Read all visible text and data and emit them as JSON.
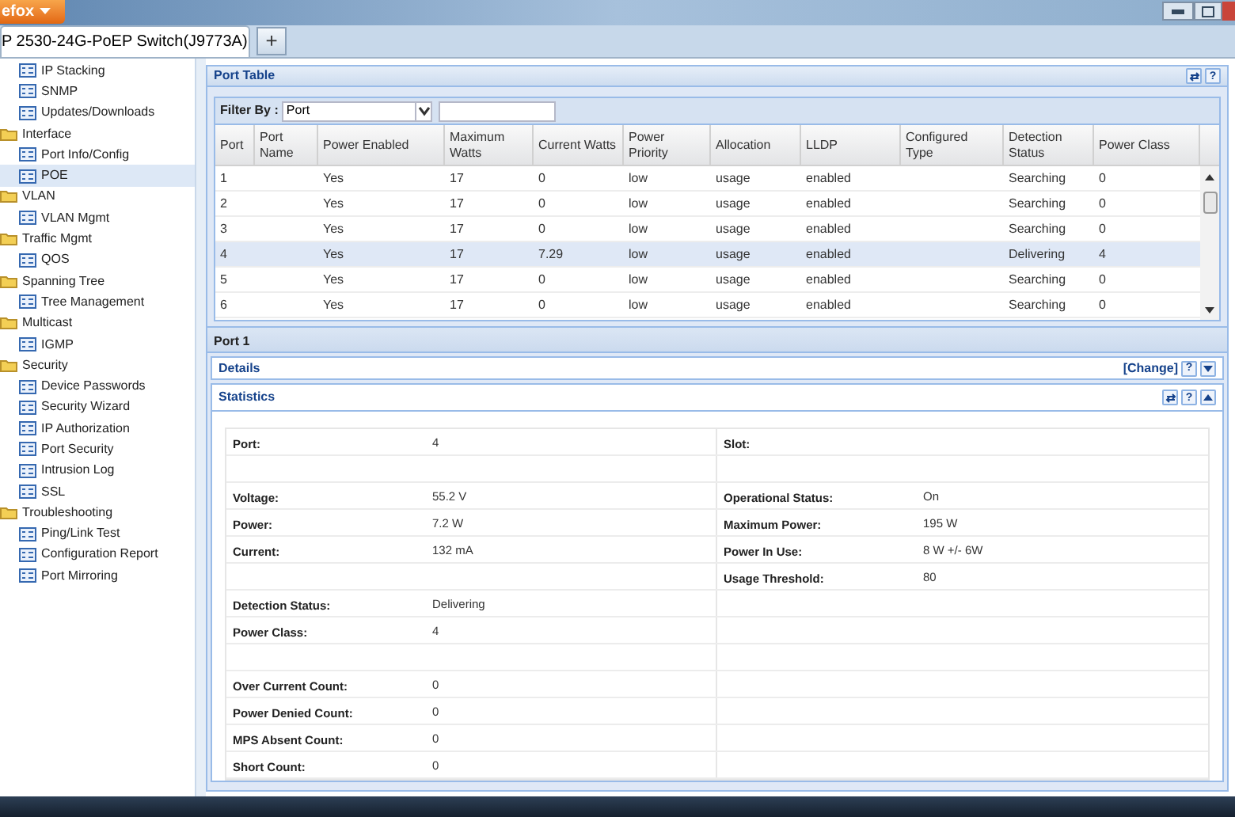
{
  "browser": {
    "menu_button": "efox",
    "tab_title": "P 2530-24G-PoEP Switch(J9773A)",
    "new_tab": "+"
  },
  "sidebar": {
    "items": [
      {
        "kind": "page",
        "label": "IP Stacking",
        "selected": false
      },
      {
        "kind": "page",
        "label": "SNMP",
        "selected": false
      },
      {
        "kind": "page",
        "label": "Updates/Downloads",
        "selected": false
      },
      {
        "kind": "folder",
        "label": "Interface",
        "selected": false,
        "children": [
          {
            "kind": "page",
            "label": "Port Info/Config",
            "selected": false
          },
          {
            "kind": "page",
            "label": "POE",
            "selected": true
          }
        ]
      },
      {
        "kind": "folder",
        "label": "VLAN",
        "selected": false,
        "children": [
          {
            "kind": "page",
            "label": "VLAN Mgmt",
            "selected": false
          }
        ]
      },
      {
        "kind": "folder",
        "label": "Traffic Mgmt",
        "selected": false,
        "children": [
          {
            "kind": "page",
            "label": "QOS",
            "selected": false
          }
        ]
      },
      {
        "kind": "folder",
        "label": "Spanning Tree",
        "selected": false,
        "children": [
          {
            "kind": "page",
            "label": "Tree Management",
            "selected": false
          }
        ]
      },
      {
        "kind": "folder",
        "label": "Multicast",
        "selected": false,
        "children": [
          {
            "kind": "page",
            "label": "IGMP",
            "selected": false
          }
        ]
      },
      {
        "kind": "folder",
        "label": "Security",
        "selected": false,
        "children": [
          {
            "kind": "page",
            "label": "Device Passwords",
            "selected": false
          },
          {
            "kind": "page",
            "label": "Security Wizard",
            "selected": false
          },
          {
            "kind": "page",
            "label": "IP Authorization",
            "selected": false
          },
          {
            "kind": "page",
            "label": "Port Security",
            "selected": false
          },
          {
            "kind": "page",
            "label": "Intrusion Log",
            "selected": false
          },
          {
            "kind": "page",
            "label": "SSL",
            "selected": false
          }
        ]
      },
      {
        "kind": "folder",
        "label": "Troubleshooting",
        "selected": false,
        "children": [
          {
            "kind": "page",
            "label": "Ping/Link Test",
            "selected": false
          },
          {
            "kind": "page",
            "label": "Configuration Report",
            "selected": false
          },
          {
            "kind": "page",
            "label": "Port Mirroring",
            "selected": false
          }
        ]
      }
    ]
  },
  "port_table": {
    "title": "Port Table",
    "tools": [
      {
        "kind": "refresh"
      },
      {
        "kind": "help",
        "label": "?"
      }
    ],
    "filter": {
      "label": "Filter By :",
      "value": "Port"
    },
    "columns": [
      "Port",
      "Port Name",
      "Power Enabled",
      "Maximum Watts",
      "Current Watts",
      "Power Priority",
      "Allocation",
      "LLDP",
      "Configured Type",
      "Detection Status",
      "Power Class"
    ],
    "rows": [
      {
        "selected": false,
        "cells": [
          "1",
          "",
          "Yes",
          "17",
          "0",
          "low",
          "usage",
          "enabled",
          "",
          "Searching",
          "0"
        ]
      },
      {
        "selected": false,
        "cells": [
          "2",
          "",
          "Yes",
          "17",
          "0",
          "low",
          "usage",
          "enabled",
          "",
          "Searching",
          "0"
        ]
      },
      {
        "selected": false,
        "cells": [
          "3",
          "",
          "Yes",
          "17",
          "0",
          "low",
          "usage",
          "enabled",
          "",
          "Searching",
          "0"
        ]
      },
      {
        "selected": true,
        "cells": [
          "4",
          "",
          "Yes",
          "17",
          "7.29",
          "low",
          "usage",
          "enabled",
          "",
          "Delivering",
          "4"
        ]
      },
      {
        "selected": false,
        "cells": [
          "5",
          "",
          "Yes",
          "17",
          "0",
          "low",
          "usage",
          "enabled",
          "",
          "Searching",
          "0"
        ]
      },
      {
        "selected": false,
        "cells": [
          "6",
          "",
          "Yes",
          "17",
          "0",
          "low",
          "usage",
          "enabled",
          "",
          "Searching",
          "0"
        ]
      }
    ]
  },
  "port_header": "Port 1",
  "details": {
    "title": "Details",
    "link": "[Change]",
    "tools": [
      {
        "kind": "help",
        "label": "?"
      },
      {
        "kind": "expand"
      }
    ]
  },
  "statistics": {
    "title": "Statistics",
    "tools": [
      {
        "kind": "refresh"
      },
      {
        "kind": "help",
        "label": "?"
      },
      {
        "kind": "collapse"
      }
    ],
    "rows": [
      {
        "left": {
          "label": "Port:",
          "value": "4"
        },
        "right": {
          "label": "Slot:"
        }
      },
      {},
      {
        "left": {
          "label": "Voltage:",
          "value": "55.2 V"
        },
        "right": {
          "label": "Operational Status:",
          "value": "On"
        }
      },
      {
        "left": {
          "label": "Power:",
          "value": "7.2 W"
        },
        "right": {
          "label": "Maximum Power:",
          "value": "195 W"
        }
      },
      {
        "left": {
          "label": "Current:",
          "value": "132 mA"
        },
        "right": {
          "label": "Power In Use:",
          "value": "8 W +/- 6W"
        }
      },
      {
        "right": {
          "label": "Usage Threshold:",
          "value": "80"
        }
      },
      {
        "left": {
          "label": "Detection Status:",
          "value": "Delivering"
        }
      },
      {
        "left": {
          "label": "Power Class:",
          "value": "4"
        }
      },
      {},
      {
        "left": {
          "label": "Over Current Count:",
          "value": "0"
        }
      },
      {
        "left": {
          "label": "Power Denied Count:",
          "value": "0"
        }
      },
      {
        "left": {
          "label": "MPS Absent Count:",
          "value": "0"
        }
      },
      {
        "left": {
          "label": "Short Count:",
          "value": "0"
        }
      }
    ]
  }
}
